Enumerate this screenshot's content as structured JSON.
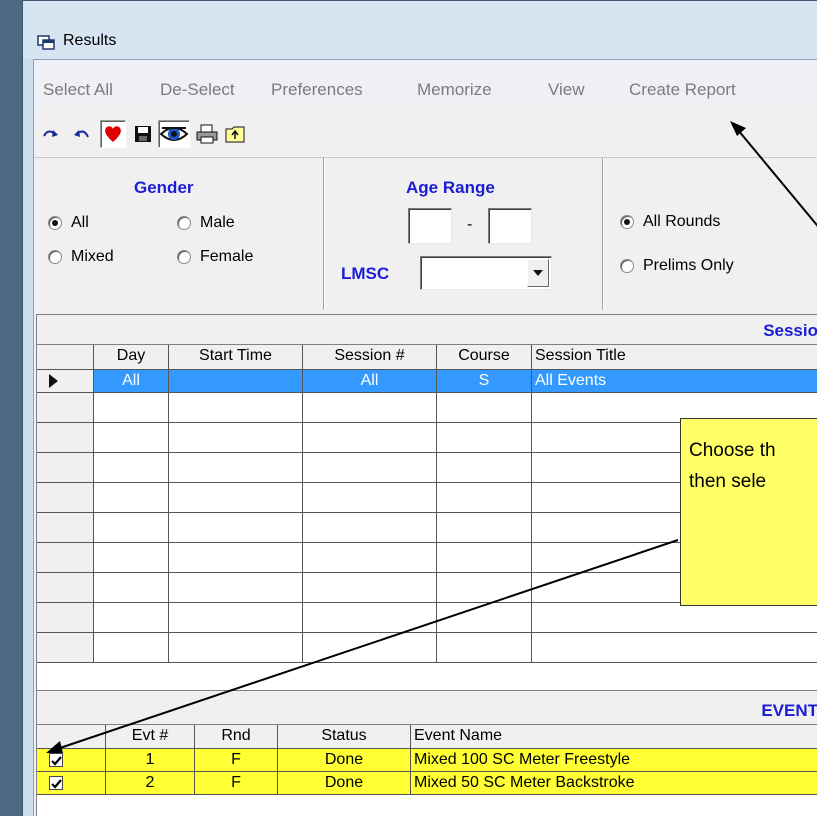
{
  "window": {
    "title": "Results"
  },
  "menu": [
    "Select All",
    "De-Select",
    "Preferences",
    "Memorize",
    "View",
    "Create Report"
  ],
  "toolbar_icons": [
    "redo-icon",
    "undo-icon",
    "heart-icon",
    "save-icon",
    "eye-icon",
    "print-icon",
    "export-icon"
  ],
  "filters": {
    "gender": {
      "title": "Gender",
      "options": [
        "All",
        "Male",
        "Mixed",
        "Female"
      ],
      "selected": "All"
    },
    "age_range": {
      "title": "Age Range",
      "separator": "-",
      "min": "",
      "max": ""
    },
    "lmsc": {
      "label": "LMSC",
      "value": ""
    },
    "rounds": {
      "options": [
        "All Rounds",
        "Prelims Only"
      ],
      "selected": "All Rounds"
    }
  },
  "sessions": {
    "caption": "Sessio",
    "columns": [
      "Day",
      "Start Time",
      "Session #",
      "Course",
      "Session Title"
    ],
    "rows": [
      {
        "day": "All",
        "start": "",
        "session": "All",
        "course": "S",
        "title": "All Events"
      }
    ]
  },
  "events": {
    "caption": "EVENT",
    "columns": [
      "Evt #",
      "Rnd",
      "Status",
      "Event Name"
    ],
    "rows": [
      {
        "checked": true,
        "evt": "1",
        "rnd": "F",
        "status": "Done",
        "name": "Mixed 100 SC Meter Freestyle"
      },
      {
        "checked": true,
        "evt": "2",
        "rnd": "F",
        "status": "Done",
        "name": "Mixed 50 SC Meter Backstroke"
      }
    ]
  },
  "callout": {
    "line1": "Choose th",
    "line2": "then sele"
  },
  "colors": {
    "highlight_row": "#3399ff",
    "event_row": "#ffff33",
    "callout": "#ffff66",
    "title_blue": "#1c1cd6"
  }
}
